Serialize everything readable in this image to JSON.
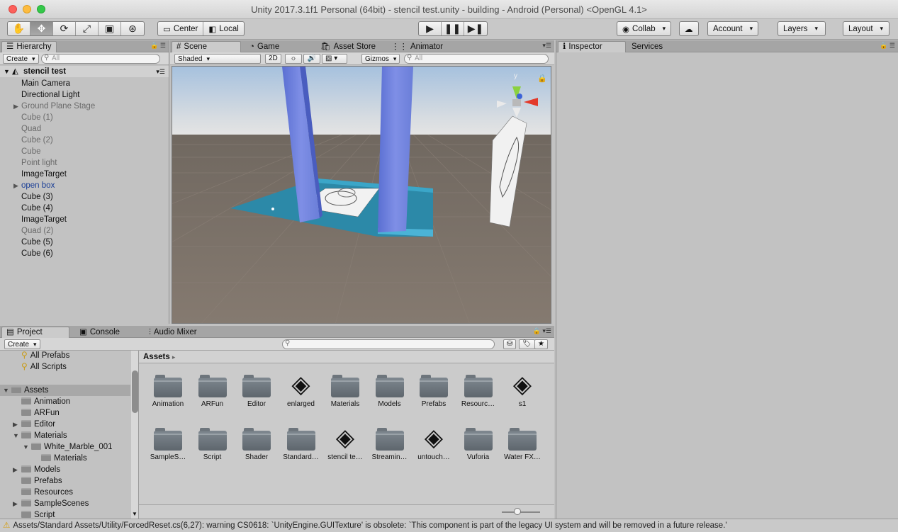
{
  "window": {
    "title": "Unity 2017.3.1f1 Personal (64bit) - stencil test.unity - building - Android (Personal) <OpenGL 4.1>"
  },
  "toolbar": {
    "tools": [
      "hand-icon",
      "move-icon",
      "rotate-icon",
      "scale-icon",
      "rect-icon",
      "transform-icon"
    ],
    "pivot_label": "Center",
    "space_label": "Local",
    "collab_label": "Collab",
    "account_label": "Account",
    "layers_label": "Layers",
    "layout_label": "Layout"
  },
  "hierarchy": {
    "tab": "Hierarchy",
    "create": "Create",
    "search_placeholder": "All",
    "scene": "stencil test",
    "items": [
      {
        "label": "Main Camera",
        "state": "normal",
        "expandable": false
      },
      {
        "label": "Directional Light",
        "state": "normal",
        "expandable": false
      },
      {
        "label": "Ground Plane Stage",
        "state": "dim",
        "expandable": true
      },
      {
        "label": "Cube (1)",
        "state": "dim",
        "expandable": false
      },
      {
        "label": "Quad",
        "state": "dim",
        "expandable": false
      },
      {
        "label": "Cube (2)",
        "state": "dim",
        "expandable": false
      },
      {
        "label": "Cube",
        "state": "dim",
        "expandable": false
      },
      {
        "label": "Point light",
        "state": "dim",
        "expandable": false
      },
      {
        "label": "ImageTarget",
        "state": "normal",
        "expandable": false
      },
      {
        "label": "open box",
        "state": "prefab",
        "expandable": true
      },
      {
        "label": "Cube (3)",
        "state": "normal",
        "expandable": false
      },
      {
        "label": "Cube (4)",
        "state": "normal",
        "expandable": false
      },
      {
        "label": "ImageTarget",
        "state": "normal",
        "expandable": false
      },
      {
        "label": "Quad (2)",
        "state": "dim",
        "expandable": false
      },
      {
        "label": "Cube (5)",
        "state": "normal",
        "expandable": false
      },
      {
        "label": "Cube (6)",
        "state": "normal",
        "expandable": false
      }
    ]
  },
  "scene_view": {
    "tabs": [
      "Scene",
      "Game",
      "Asset Store",
      "Animator"
    ],
    "shading": "Shaded",
    "mode_2d": "2D",
    "gizmos": "Gizmos",
    "search_placeholder": "All",
    "axis_y": "y"
  },
  "inspector": {
    "tabs": [
      "Inspector",
      "Services"
    ]
  },
  "project": {
    "tabs": [
      "Project",
      "Console",
      "Audio Mixer"
    ],
    "create": "Create",
    "breadcrumb": "Assets",
    "tree": [
      {
        "label": "All Prefabs",
        "indent": 1,
        "kind": "search"
      },
      {
        "label": "All Scripts",
        "indent": 1,
        "kind": "search"
      },
      {
        "label": "Assets",
        "indent": 0,
        "kind": "folder",
        "expanded": true,
        "selected": true
      },
      {
        "label": "Animation",
        "indent": 1,
        "kind": "folder"
      },
      {
        "label": "ARFun",
        "indent": 1,
        "kind": "folder"
      },
      {
        "label": "Editor",
        "indent": 1,
        "kind": "folder",
        "collapsed": true
      },
      {
        "label": "Materials",
        "indent": 1,
        "kind": "folder",
        "expanded": true
      },
      {
        "label": "White_Marble_001",
        "indent": 2,
        "kind": "folder",
        "expanded": true
      },
      {
        "label": "Materials",
        "indent": 3,
        "kind": "folder"
      },
      {
        "label": "Models",
        "indent": 1,
        "kind": "folder",
        "collapsed": true
      },
      {
        "label": "Prefabs",
        "indent": 1,
        "kind": "folder"
      },
      {
        "label": "Resources",
        "indent": 1,
        "kind": "folder"
      },
      {
        "label": "SampleScenes",
        "indent": 1,
        "kind": "folder",
        "collapsed": true
      },
      {
        "label": "Script",
        "indent": 1,
        "kind": "folder"
      }
    ],
    "assets": [
      {
        "label": "Animation",
        "kind": "folder"
      },
      {
        "label": "ARFun",
        "kind": "folder"
      },
      {
        "label": "Editor",
        "kind": "folder"
      },
      {
        "label": "enlarged",
        "kind": "unity"
      },
      {
        "label": "Materials",
        "kind": "folder"
      },
      {
        "label": "Models",
        "kind": "folder"
      },
      {
        "label": "Prefabs",
        "kind": "folder"
      },
      {
        "label": "Resourc…",
        "kind": "folder"
      },
      {
        "label": "s1",
        "kind": "unity"
      },
      {
        "label": "SampleS…",
        "kind": "folder"
      },
      {
        "label": "Script",
        "kind": "folder"
      },
      {
        "label": "Shader",
        "kind": "folder"
      },
      {
        "label": "Standard…",
        "kind": "folder"
      },
      {
        "label": "stencil te…",
        "kind": "unity"
      },
      {
        "label": "Streamin…",
        "kind": "folder"
      },
      {
        "label": "untouch…",
        "kind": "unity"
      },
      {
        "label": "Vuforia",
        "kind": "folder"
      },
      {
        "label": "Water FX…",
        "kind": "folder"
      }
    ]
  },
  "status": {
    "message": "Assets/Standard Assets/Utility/ForcedReset.cs(6,27): warning CS0618: `UnityEngine.GUITexture' is obsolete: `This component is part of the legacy UI system and will be removed in a future release.'"
  }
}
